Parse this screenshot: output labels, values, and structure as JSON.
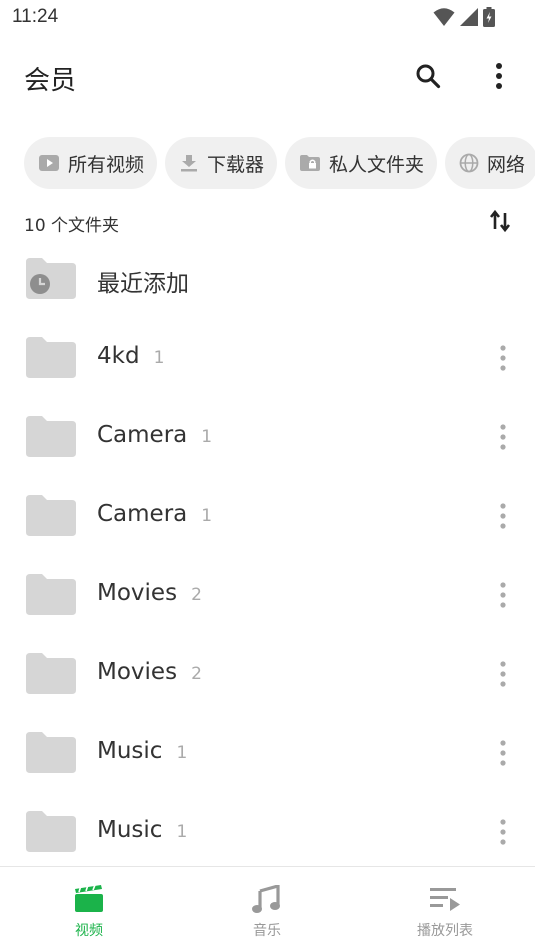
{
  "status_bar": {
    "time": "11:24"
  },
  "app_bar": {
    "title": "会员",
    "search_icon": "search-icon",
    "more_icon": "more-vert-icon"
  },
  "chips": [
    {
      "label": "所有视频",
      "icon": "play-icon"
    },
    {
      "label": "下载器",
      "icon": "download-icon"
    },
    {
      "label": "私人文件夹",
      "icon": "lock-folder-icon"
    },
    {
      "label": "网络",
      "icon": "globe-icon"
    }
  ],
  "folder_count": "10 个文件夹",
  "folders": [
    {
      "name": "最近添加",
      "count": "",
      "recent": true
    },
    {
      "name": "4kd",
      "count": "1"
    },
    {
      "name": "Camera",
      "count": "1"
    },
    {
      "name": "Camera",
      "count": "1"
    },
    {
      "name": "Movies",
      "count": "2"
    },
    {
      "name": "Movies",
      "count": "2"
    },
    {
      "name": "Music",
      "count": "1"
    },
    {
      "name": "Music",
      "count": "1"
    }
  ],
  "bottom_nav": [
    {
      "label": "视频",
      "icon": "video-clapper-icon",
      "active": true
    },
    {
      "label": "音乐",
      "icon": "music-note-icon",
      "active": false
    },
    {
      "label": "播放列表",
      "icon": "playlist-icon",
      "active": false
    }
  ],
  "colors": {
    "accent": "#1bb34a",
    "folder": "#d6d6d6",
    "chip_bg": "#f0f0f0"
  }
}
